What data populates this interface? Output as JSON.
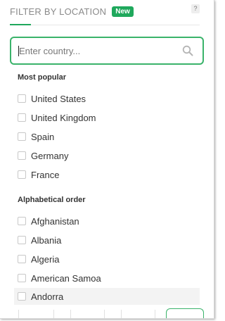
{
  "header": {
    "title": "FILTER BY LOCATION",
    "badge": "New",
    "help": "?"
  },
  "search": {
    "placeholder": "Enter country...",
    "value": ""
  },
  "sections": {
    "popular_label": "Most popular",
    "alpha_label": "Alphabetical order"
  },
  "popular": [
    {
      "label": "United States",
      "checked": false
    },
    {
      "label": "United Kingdom",
      "checked": false
    },
    {
      "label": "Spain",
      "checked": false
    },
    {
      "label": "Germany",
      "checked": false
    },
    {
      "label": "France",
      "checked": false
    }
  ],
  "alphabetical": [
    {
      "label": "Afghanistan",
      "checked": false
    },
    {
      "label": "Albania",
      "checked": false
    },
    {
      "label": "Algeria",
      "checked": false
    },
    {
      "label": "American Samoa",
      "checked": false
    },
    {
      "label": "Andorra",
      "checked": false
    }
  ],
  "colors": {
    "accent": "#1fa85c",
    "border": "#3ab36a",
    "hover_row": "#f3f3f3"
  },
  "icons": {
    "search": "search-icon",
    "help": "help-icon"
  }
}
